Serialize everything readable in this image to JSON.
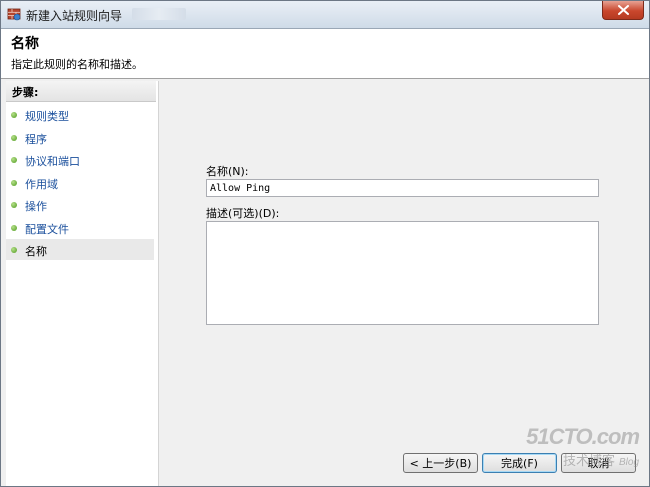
{
  "window": {
    "title": "新建入站规则向导",
    "close_icon": "close-icon"
  },
  "header": {
    "title": "名称",
    "description": "指定此规则的名称和描述。"
  },
  "steps": {
    "heading": "步骤:",
    "items": [
      {
        "label": "规则类型",
        "current": false
      },
      {
        "label": "程序",
        "current": false
      },
      {
        "label": "协议和端口",
        "current": false
      },
      {
        "label": "作用域",
        "current": false
      },
      {
        "label": "操作",
        "current": false
      },
      {
        "label": "配置文件",
        "current": false
      },
      {
        "label": "名称",
        "current": true
      }
    ]
  },
  "form": {
    "name_label": "名称(N):",
    "name_value": "Allow Ping",
    "description_label": "描述(可选)(D):",
    "description_value": ""
  },
  "buttons": {
    "back": "< 上一步(B)",
    "finish": "完成(F)",
    "cancel": "取消"
  },
  "watermark": {
    "logo": "51CTO.com",
    "subtitle": "技术博客",
    "blog": "Blog"
  },
  "colors": {
    "step_link": "#1a4f9c",
    "step_dot": "#4d9a1e",
    "close_button": "#c9472d"
  }
}
